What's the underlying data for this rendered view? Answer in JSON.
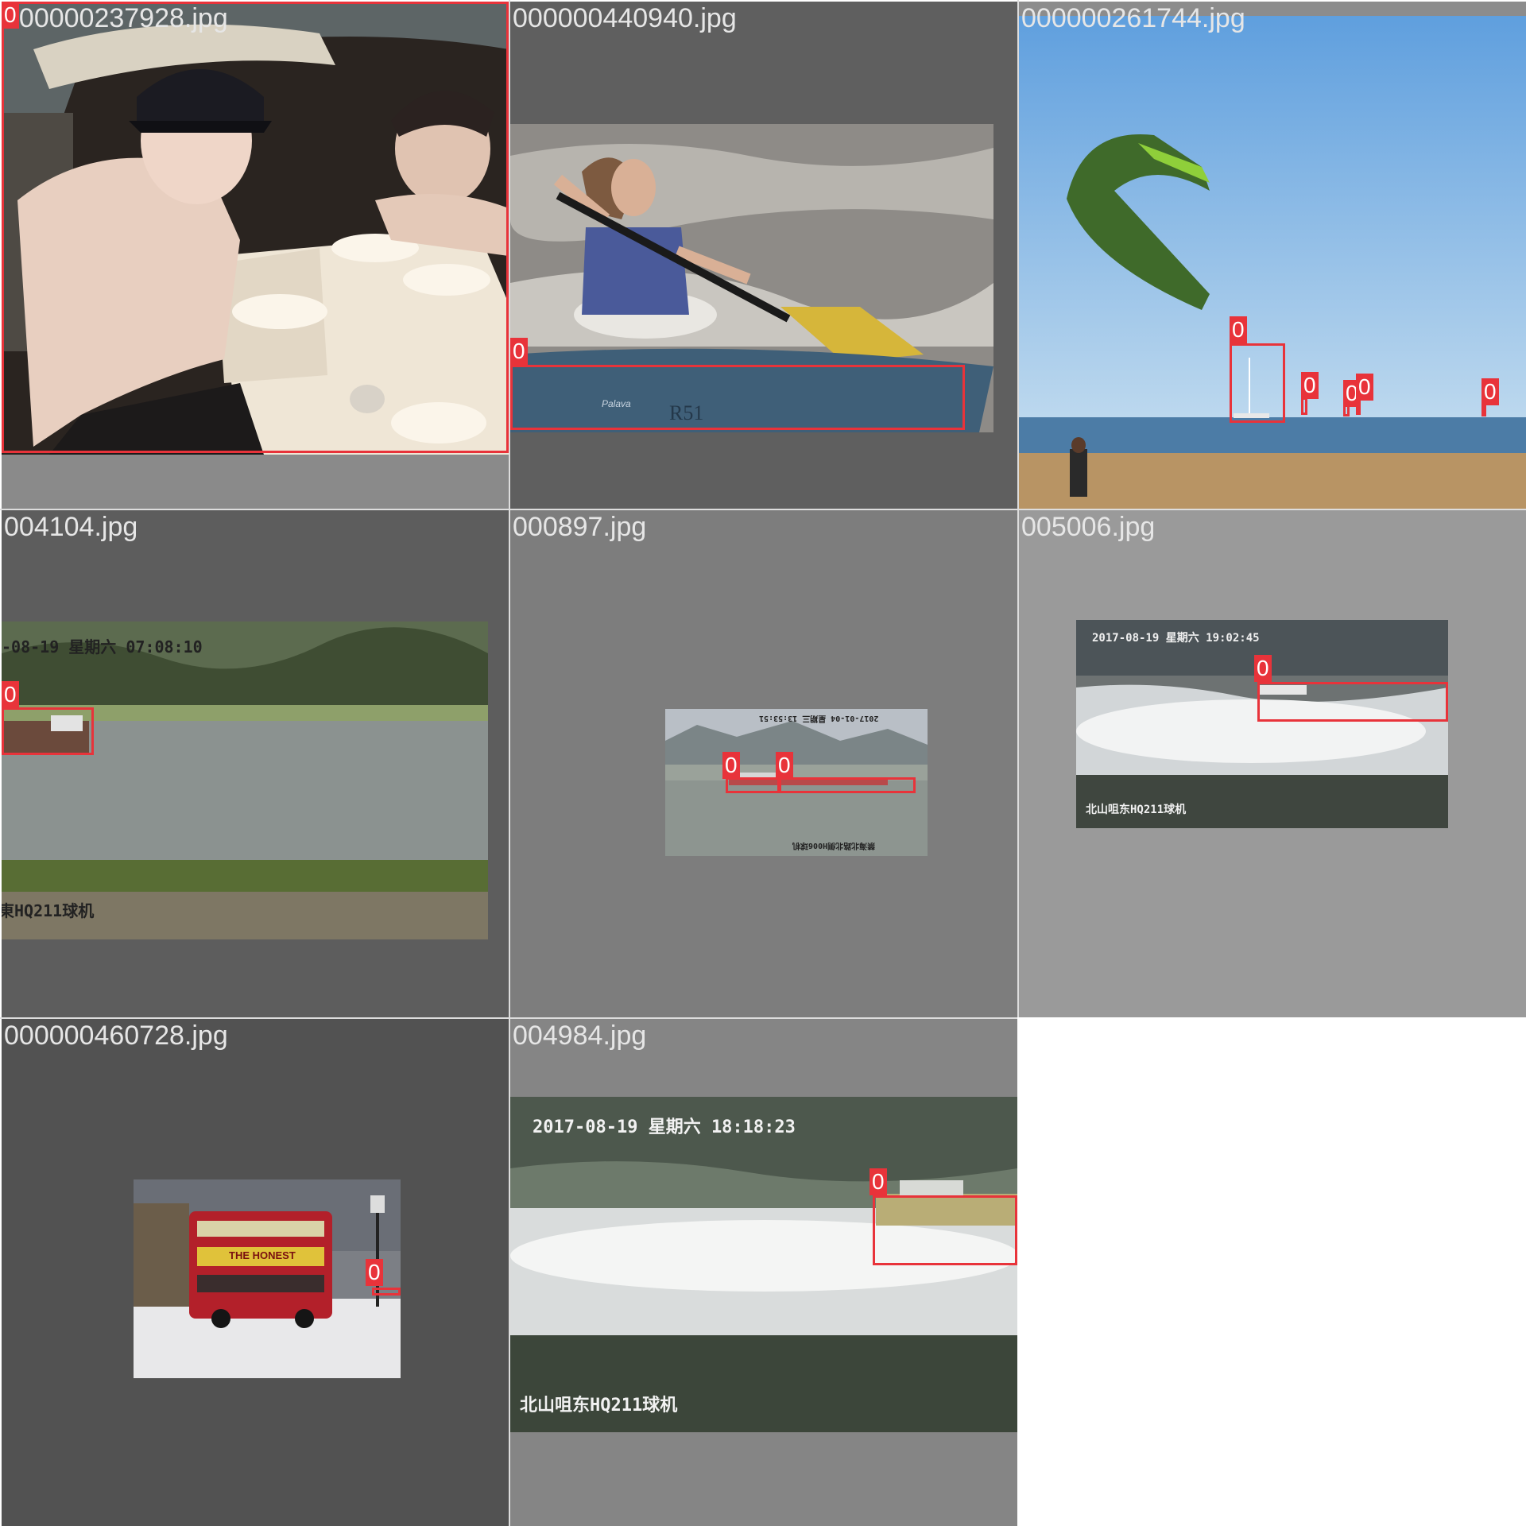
{
  "tiles": [
    {
      "filename": "000000237928.jpg",
      "labels": [
        "0"
      ]
    },
    {
      "filename": "000000440940.jpg",
      "labels": [
        "0"
      ],
      "hull_text": "Palava",
      "hull_number": "R51"
    },
    {
      "filename": "000000261744.jpg",
      "labels": [
        "0",
        "0",
        "0",
        "0",
        "0"
      ]
    },
    {
      "filename": "004104.jpg",
      "labels": [
        "0"
      ],
      "stamp_top": "-08-19 星期六 07:08:10",
      "stamp_bottom": "東HQ211球机"
    },
    {
      "filename": "000897.jpg",
      "labels": [
        "0",
        "0"
      ],
      "stamp_top": "2017-01-04 星期三 13:53:51",
      "stamp_bottom": "禁海北路北侧H006球机"
    },
    {
      "filename": "005006.jpg",
      "labels": [
        "0"
      ],
      "stamp_top": "2017-08-19 星期六 19:02:45",
      "stamp_bottom": "北山咀东HQ211球机"
    },
    {
      "filename": "000000460728.jpg",
      "labels": [
        "0"
      ],
      "bus_banner": "THE HONEST"
    },
    {
      "filename": "004984.jpg",
      "labels": [
        "0"
      ],
      "stamp_top": "2017-08-19 星期六 18:18:23",
      "stamp_bottom": "北山咀东HQ211球机"
    }
  ],
  "colors": {
    "box": "#e8333a",
    "label_text": "#ffffff",
    "filename_text": "#e6e6e6",
    "background": "#ffffff"
  }
}
